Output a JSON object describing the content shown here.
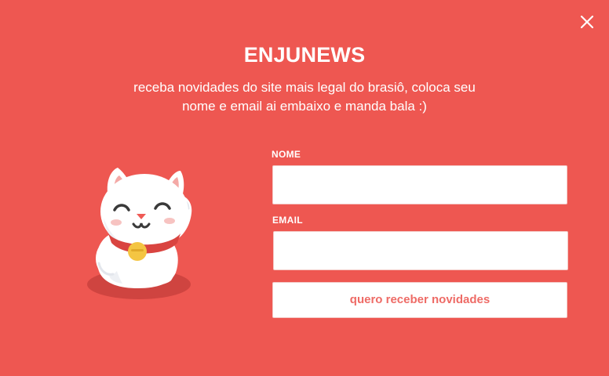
{
  "modal": {
    "background_color": "#ee5751",
    "title": "ENJUNEWS",
    "subtitle_line1": "receba novidades do site mais legal do brasiô, coloca seu",
    "subtitle_line2": "nome e email ai embaixo e manda bala :)",
    "close_icon": "close-icon",
    "mascot_icon": "lucky-cat-icon"
  },
  "form": {
    "name_label": "NOME",
    "name_value": "",
    "email_label": "EMAIL",
    "email_value": "",
    "submit_label": "quero receber novidades",
    "accent_color": "#ee6b66"
  }
}
